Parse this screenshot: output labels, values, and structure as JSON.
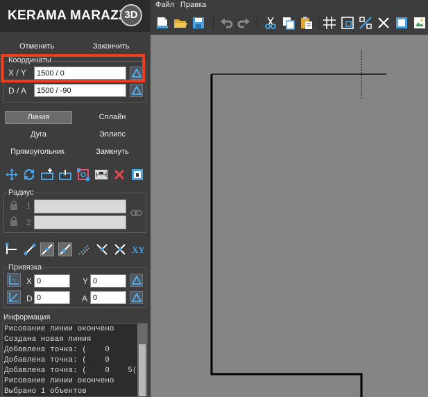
{
  "app": {
    "logo_text": "KERAMA MARAZZI",
    "logo_badge": "3D"
  },
  "menu": {
    "file": "Файл",
    "edit": "Правка"
  },
  "actions": {
    "cancel": "Отменить",
    "finish": "Закончить"
  },
  "coordinates": {
    "title": "Координаты",
    "xy_label": "X / Y",
    "xy_value": "1500 / 0",
    "da_label": "D / A",
    "da_value": "1500 / -90"
  },
  "modes": {
    "line": "Линия",
    "spline": "Сплайн",
    "arc": "Дуга",
    "ellipse": "Эллипс",
    "rectangle": "Прямоугольник",
    "close": "Замкнуть"
  },
  "radius": {
    "title": "Радиус",
    "row1": "1",
    "row2": "2"
  },
  "snap": {
    "title": "Привязка",
    "x_label": "X",
    "x_value": "0",
    "y_label": "Y",
    "y_value": "0",
    "d_label": "D",
    "d_value": "0",
    "a_label": "A",
    "a_value": "0",
    "xy_tool": "XY"
  },
  "info": {
    "title": "Информация",
    "lines": [
      "Рисование линии окончено",
      "Создана новая линия",
      "Добавлена точка: (    0",
      "Добавлена точка: (    0",
      "Добавлена точка: (    0    5(",
      "Рисование линии окончено",
      "Выбрано 1 объектов"
    ]
  },
  "colors": {
    "highlight": "#ee3a1d",
    "accent_blue": "#4aa3e0",
    "panel": "#3d3d3d",
    "canvas": "#858585"
  }
}
